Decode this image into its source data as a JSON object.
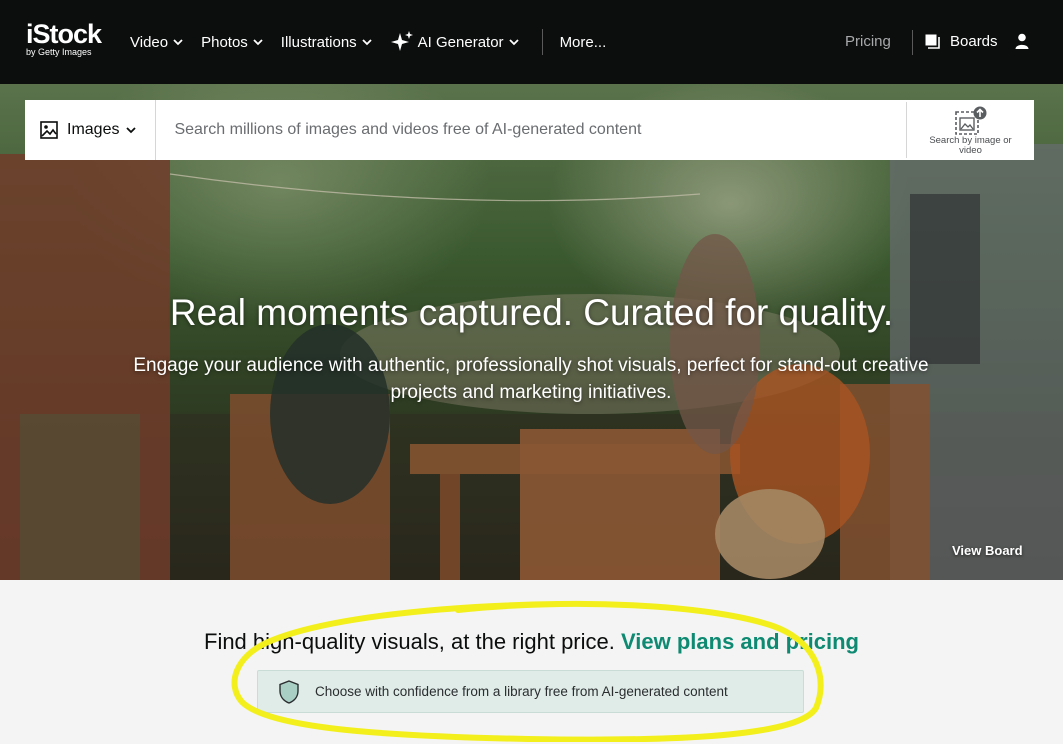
{
  "header": {
    "logo": {
      "main": "iStock",
      "sub": "by Getty Images"
    },
    "nav": [
      {
        "label": "Video"
      },
      {
        "label": "Photos"
      },
      {
        "label": "Illustrations"
      },
      {
        "label": "AI Generator"
      },
      {
        "label": "More..."
      }
    ],
    "pricing": "Pricing",
    "boards": "Boards"
  },
  "search": {
    "media_type": "Images",
    "placeholder": "Search millions of images and videos free of AI-generated content",
    "image_search_label": "Search by image or video"
  },
  "hero": {
    "title": "Real moments captured. Curated for quality.",
    "subtitle": "Engage your audience with authentic, professionally shot visuals, perfect for stand-out creative projects and marketing initiatives.",
    "view_board": "View Board"
  },
  "promo": {
    "text": "Find high-quality visuals, at the right price.",
    "link": "View plans and pricing",
    "badge_text": "Choose with confidence from a library free from AI-generated content"
  },
  "colors": {
    "header_bg": "#0c0d0d",
    "accent_green": "#0f8a72",
    "badge_bg": "#dfece8",
    "highlight_yellow": "#f2ef1d"
  },
  "icons": [
    "chevron-down-icon",
    "sparkle-icon",
    "boards-icon",
    "user-icon",
    "image-icon",
    "image-search-icon",
    "shield-icon"
  ]
}
